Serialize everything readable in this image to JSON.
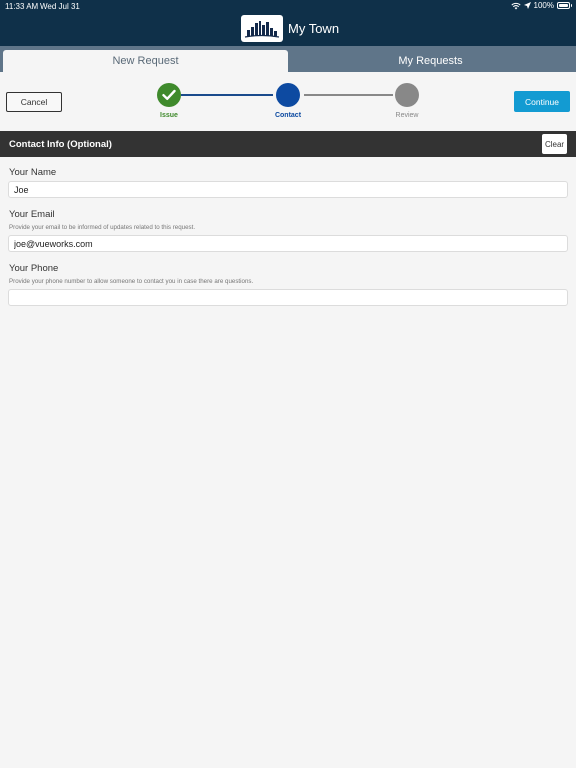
{
  "status_bar": {
    "time": "11:33 AM",
    "date": "Wed Jul 31",
    "battery": "100%",
    "wifi_icon": "wifi-icon",
    "location_icon": "location-arrow-icon",
    "battery_icon": "battery-icon"
  },
  "header": {
    "title": "My Town",
    "logo_icon": "city-skyline-logo"
  },
  "tabs": [
    {
      "label": "New Request",
      "active": true
    },
    {
      "label": "My Requests",
      "active": false
    }
  ],
  "toolbar": {
    "cancel_label": "Cancel",
    "continue_label": "Continue"
  },
  "stepper": {
    "steps": [
      {
        "label": "Issue",
        "state": "complete"
      },
      {
        "label": "Contact",
        "state": "current"
      },
      {
        "label": "Review",
        "state": "pending"
      }
    ]
  },
  "section": {
    "title": "Contact Info (Optional)",
    "clear_label": "Clear"
  },
  "form": {
    "name": {
      "label": "Your Name",
      "value": "Joe"
    },
    "email": {
      "label": "Your Email",
      "help": "Provide your email to be informed of updates related to this request.",
      "value": "joe@vueworks.com"
    },
    "phone": {
      "label": "Your Phone",
      "help": "Provide your phone number to allow someone to contact you in case there are questions.",
      "value": ""
    }
  },
  "colors": {
    "header_bg": "#0f3049",
    "tabs_bg": "#5f7589",
    "accent": "#139bd2",
    "complete": "#3f8a2c",
    "current": "#0d4aa1",
    "pending": "#888888",
    "section_bg": "#333333"
  }
}
